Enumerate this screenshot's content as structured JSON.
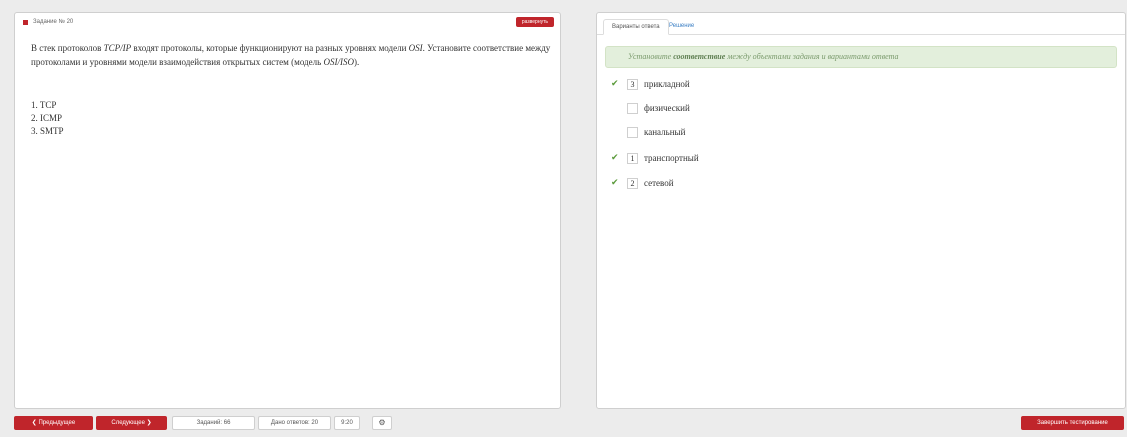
{
  "task": {
    "header": "Задание № 20",
    "expand_label": "развернуть",
    "question_part1": "В стек протоколов ",
    "question_term1": "TCP/IP",
    "question_part2": " входят протоколы, которые функционируют на разных уровнях модели ",
    "question_term2": "OSI",
    "question_part3": ". Установите соответствие между протоколами и уровнями модели взаимодействия открытых систем (модель ",
    "question_term3": "OSI/ISO",
    "question_part4": ").",
    "options": [
      "1. TCP",
      "2. ICMP",
      "3. SMTP"
    ]
  },
  "answers_panel": {
    "tab_active": "Варианты ответа",
    "tab_link": "Решение",
    "hint_pre": "Установите ",
    "hint_bold": "соответствие",
    "hint_post": " между объектами задания и вариантами ответа",
    "rows": [
      {
        "checked": true,
        "value": "3",
        "label": "прикладной"
      },
      {
        "checked": false,
        "value": "",
        "label": "физический"
      },
      {
        "checked": false,
        "value": "",
        "label": "канальный"
      },
      {
        "checked": true,
        "value": "1",
        "label": "транспортный"
      },
      {
        "checked": true,
        "value": "2",
        "label": "сетевой"
      }
    ]
  },
  "footer": {
    "prev_label": "❮ Предыдущее",
    "next_label": "Следующее ❯",
    "tasks_label": "Заданий: 66",
    "answers_label": "Дано ответов: 20",
    "timer": "9:20",
    "settings_icon": "gear-icon",
    "finish_label": "Завершить тестирование"
  },
  "colors": {
    "accent_red": "#c0252b",
    "hint_green": "#e3efdc",
    "check_green": "#5a9a3a",
    "link_blue": "#3b7fc4"
  }
}
